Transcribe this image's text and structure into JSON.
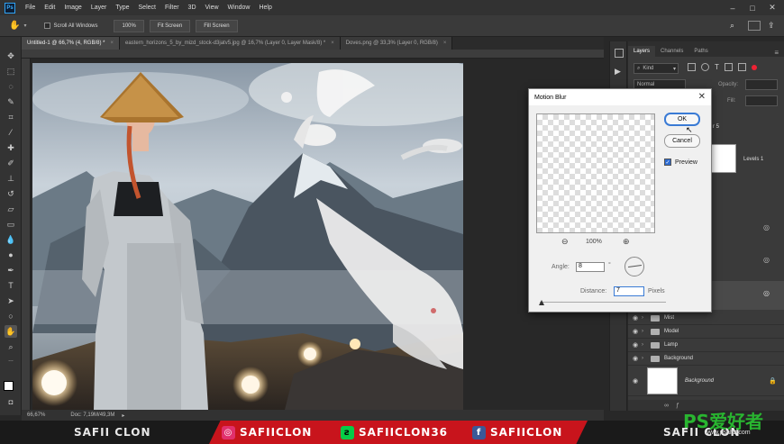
{
  "menubar": {
    "logo": "Ps",
    "items": [
      "File",
      "Edit",
      "Image",
      "Layer",
      "Type",
      "Select",
      "Filter",
      "3D",
      "View",
      "Window",
      "Help"
    ]
  },
  "options": {
    "scroll_all_windows": "Scroll All Windows",
    "zoom_pct": "100%",
    "fit_screen": "Fit Screen",
    "fill_screen": "Fill Screen"
  },
  "tabs": [
    {
      "label": "Untitled-1 @ 66,7% (4, RGB/8) *",
      "active": true
    },
    {
      "label": "eastern_horizons_5_by_mizd_stock-d3jatv5.jpg @ 16,7% (Layer 0, Layer Mask/8) *",
      "active": false
    },
    {
      "label": "Doves.png @ 33,3% (Layer 0, RGB/8)",
      "active": false
    }
  ],
  "status": {
    "zoom": "66,67%",
    "doc": "Doc: 7,19M/49,3M"
  },
  "layers_panel": {
    "tabs": [
      "Layers",
      "Channels",
      "Paths"
    ],
    "kind": "Kind",
    "blend_mode": "Normal",
    "opacity_label": "Opacity:",
    "fill_label": "Fill:",
    "adjust_label": "Levels 1",
    "partial_label": "r 5",
    "groups": [
      "Mist",
      "Model",
      "Lamp",
      "Background"
    ],
    "background_layer": "Background"
  },
  "dialog": {
    "title": "Motion Blur",
    "ok": "OK",
    "cancel": "Cancel",
    "preview_label": "Preview",
    "preview_checked": true,
    "zoom": "100%",
    "angle_label": "Angle:",
    "angle_value": "8",
    "angle_unit": "°",
    "distance_label": "Distance:",
    "distance_value": "7",
    "distance_unit": "Pixels"
  },
  "banner": {
    "name": "SAFII CLON",
    "instagram": "SAFIICLON",
    "deviantart": "SAFIICLON36",
    "facebook": "SAFIICLON",
    "name_right": "SAFII CLON"
  },
  "watermark": {
    "text": "PS爱好者",
    "url": "www.psahz.com"
  },
  "colors": {
    "accent": "#3a7bd5",
    "banner_red": "#c8141c",
    "ps_blue": "#2fa3f5"
  }
}
